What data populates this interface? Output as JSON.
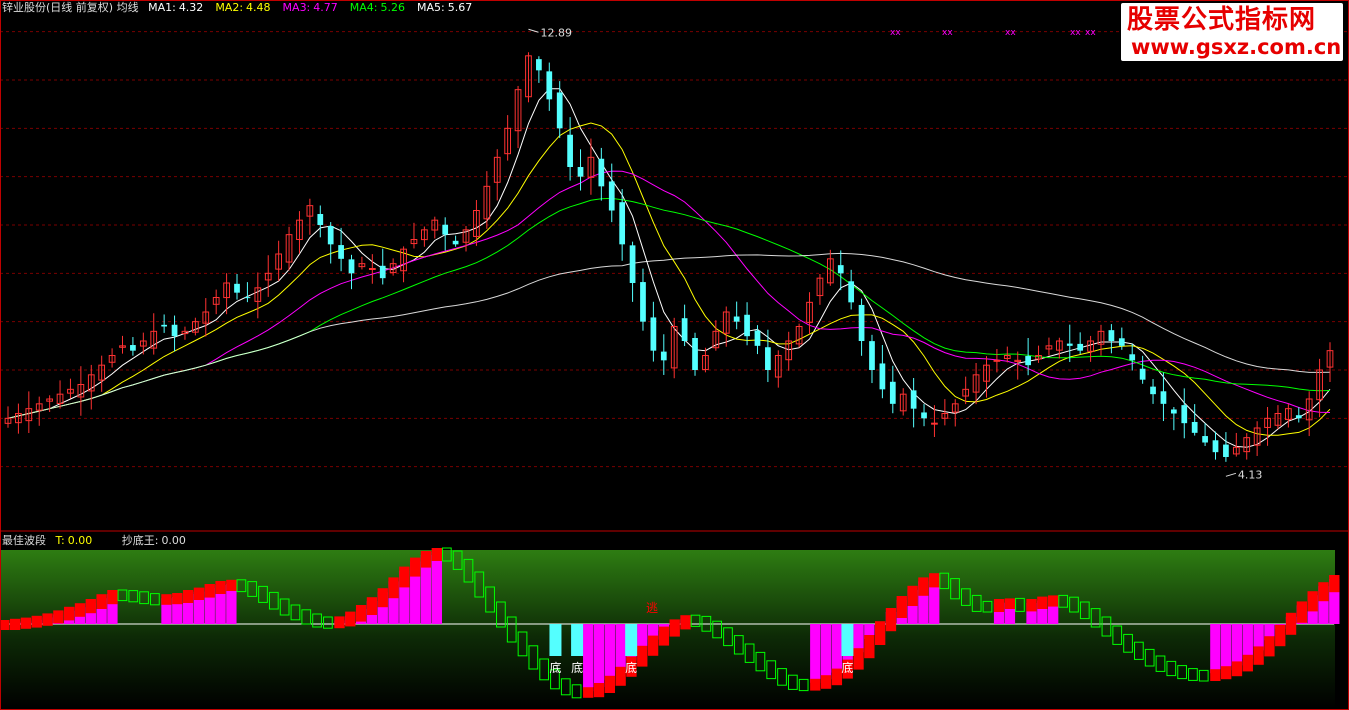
{
  "header": {
    "title": "锌业股份(日线 前复权) 均线",
    "ma": [
      {
        "label": "MA1:",
        "value": "4.32",
        "color": "#ffffff"
      },
      {
        "label": "MA2:",
        "value": "4.48",
        "color": "#ffff00"
      },
      {
        "label": "MA3:",
        "value": "4.77",
        "color": "#ff00ff"
      },
      {
        "label": "MA4:",
        "value": "5.26",
        "color": "#00ff00"
      },
      {
        "label": "MA5:",
        "value": "5.67",
        "color": "#ffffff"
      }
    ]
  },
  "indicator": {
    "name": "最佳波段",
    "t_label": "T:",
    "t_value": "0.00",
    "cdw_label": "抄底王:",
    "cdw_value": "0.00"
  },
  "brand": {
    "line1": "股票公式指标网",
    "line2": "www.gsxz.com.cn"
  },
  "chart_data": [
    {
      "type": "candlestick",
      "title": "锌业股份(日线 前复权) 均线",
      "annotations": [
        {
          "text": "12.89",
          "at": "peak"
        },
        {
          "text": "4.13",
          "at": "trough"
        }
      ],
      "ylim": [
        3.0,
        13.2
      ],
      "grid": true,
      "close_series": [
        5.0,
        5.1,
        5.2,
        5.3,
        5.4,
        5.5,
        5.6,
        5.7,
        5.9,
        6.1,
        6.3,
        6.5,
        6.4,
        6.6,
        6.8,
        6.9,
        6.7,
        6.8,
        7.0,
        7.2,
        7.5,
        7.8,
        7.6,
        7.5,
        7.7,
        8.0,
        8.4,
        8.8,
        9.1,
        9.4,
        9.0,
        8.6,
        8.3,
        8.0,
        8.2,
        8.1,
        7.9,
        8.2,
        8.5,
        8.7,
        8.9,
        9.1,
        8.8,
        8.6,
        8.9,
        9.3,
        9.8,
        10.4,
        11.0,
        11.8,
        12.5,
        12.2,
        11.6,
        11.0,
        10.2,
        10.0,
        10.4,
        9.8,
        9.3,
        8.6,
        7.8,
        7.0,
        6.4,
        6.2,
        6.9,
        6.6,
        6.0,
        6.3,
        6.8,
        7.2,
        7.0,
        6.7,
        6.5,
        6.0,
        6.3,
        6.6,
        6.9,
        7.4,
        7.9,
        8.3,
        8.0,
        7.4,
        6.6,
        6.0,
        5.6,
        5.3,
        5.5,
        5.2,
        5.0,
        4.9,
        5.1,
        5.3,
        5.6,
        5.9,
        6.1,
        6.2,
        6.3,
        6.2,
        6.1,
        6.3,
        6.5,
        6.6,
        6.5,
        6.4,
        6.6,
        6.8,
        6.6,
        6.5,
        6.2,
        5.8,
        5.5,
        5.3,
        5.1,
        4.9,
        4.7,
        4.5,
        4.3,
        4.2,
        4.4,
        4.6,
        4.8,
        5.0,
        5.1,
        5.2,
        5.0,
        5.4,
        6.0,
        6.4
      ],
      "ma_series": [
        {
          "name": "MA1",
          "value": 4.32,
          "color": "#ffffff"
        },
        {
          "name": "MA2",
          "value": 4.48,
          "color": "#ffff00"
        },
        {
          "name": "MA3",
          "value": 4.77,
          "color": "#ff00ff"
        },
        {
          "name": "MA4",
          "value": 5.26,
          "color": "#00ff00"
        },
        {
          "name": "MA5",
          "value": 5.67,
          "color": "#ffffff"
        }
      ],
      "markers": {
        "symbol": "x",
        "color": "#ff00ff",
        "count": 5
      }
    },
    {
      "type": "area",
      "title": "最佳波段",
      "values": [
        {
          "T": 0.0
        },
        {
          "抄底王": 0.0
        }
      ],
      "labels": [
        {
          "text": "底",
          "color": "#ffffff"
        },
        {
          "text": "底",
          "color": "#ffffff"
        },
        {
          "text": "底",
          "color": "#ffffff"
        },
        {
          "text": "底",
          "color": "#ffffff"
        },
        {
          "text": "逃",
          "color": "#ff0000"
        }
      ],
      "wave": [
        0.0,
        0.04,
        0.08,
        0.14,
        0.22,
        0.32,
        0.44,
        0.56,
        0.7,
        0.86,
        1.0,
        0.98,
        0.94,
        0.88,
        0.84,
        0.86,
        0.9,
        1.0,
        1.08,
        1.2,
        1.3,
        1.34,
        1.28,
        1.12,
        0.92,
        0.7,
        0.5,
        0.34,
        0.2,
        0.1,
        0.06,
        0.12,
        0.28,
        0.5,
        0.76,
        1.06,
        1.42,
        1.78,
        2.08,
        2.3,
        2.4,
        2.3,
        2.02,
        1.6,
        1.1,
        0.6,
        0.1,
        -0.4,
        -0.86,
        -1.3,
        -1.66,
        -1.96,
        -2.16,
        -2.26,
        -2.24,
        -2.1,
        -1.86,
        -1.56,
        -1.22,
        -0.86,
        -0.52,
        -0.22,
        0.02,
        0.16,
        0.12,
        -0.04,
        -0.26,
        -0.52,
        -0.8,
        -1.08,
        -1.36,
        -1.62,
        -1.84,
        -1.98,
        -2.02,
        -1.96,
        -1.84,
        -1.62,
        -1.32,
        -0.94,
        -0.5,
        -0.04,
        0.4,
        0.8,
        1.14,
        1.42,
        1.56,
        1.38,
        1.04,
        0.82,
        0.62,
        0.6,
        0.7,
        0.72,
        0.62,
        0.7,
        0.78,
        0.82,
        0.76,
        0.6,
        0.38,
        0.1,
        -0.2,
        -0.48,
        -0.74,
        -0.98,
        -1.2,
        -1.38,
        -1.52,
        -1.62,
        -1.68,
        -1.7,
        -1.64,
        -1.54,
        -1.38,
        -1.16,
        -0.88,
        -0.54,
        -0.16,
        0.24,
        0.62,
        0.96,
        1.26,
        1.5
      ]
    }
  ]
}
